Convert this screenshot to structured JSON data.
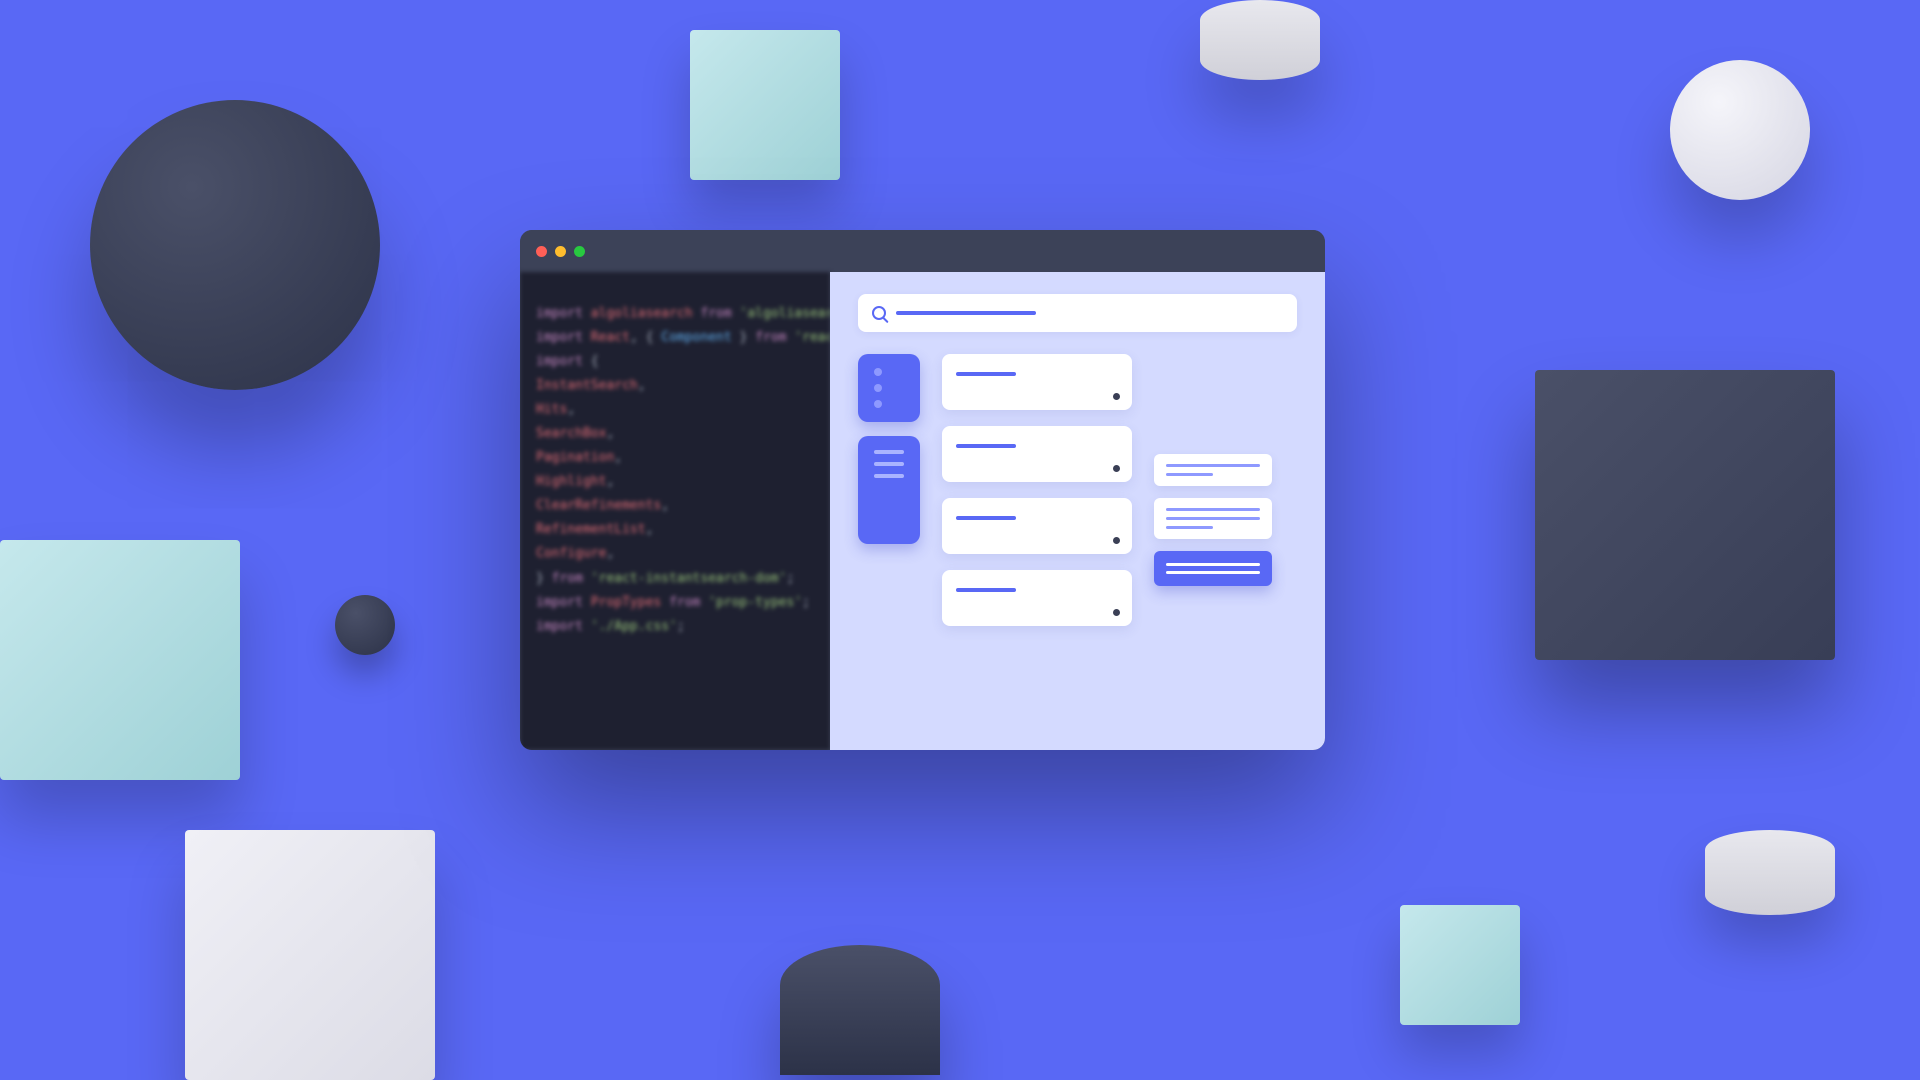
{
  "code": {
    "lines": [
      {
        "tokens": [
          [
            "kw",
            "import "
          ],
          [
            "ident",
            "algoliasearch"
          ],
          [
            "kw",
            " from "
          ],
          [
            "str",
            "'algoliasearch/lite'"
          ],
          [
            "punc",
            ";"
          ]
        ]
      },
      {
        "tokens": [
          [
            "kw",
            "import "
          ],
          [
            "ident",
            "React"
          ],
          [
            "punc",
            ", { "
          ],
          [
            "type",
            "Component"
          ],
          [
            "punc",
            " } "
          ],
          [
            "kw",
            "from "
          ],
          [
            "str",
            "'react'"
          ],
          [
            "punc",
            ";"
          ]
        ]
      },
      {
        "tokens": [
          [
            "kw",
            "import "
          ],
          [
            "punc",
            "{"
          ]
        ]
      },
      {
        "tokens": [
          [
            "ident",
            "  InstantSearch"
          ],
          [
            "punc",
            ","
          ]
        ]
      },
      {
        "tokens": [
          [
            "ident",
            "  Hits"
          ],
          [
            "punc",
            ","
          ]
        ]
      },
      {
        "tokens": [
          [
            "ident",
            "  SearchBox"
          ],
          [
            "punc",
            ","
          ]
        ]
      },
      {
        "tokens": [
          [
            "ident",
            "  Pagination"
          ],
          [
            "punc",
            ","
          ]
        ]
      },
      {
        "tokens": [
          [
            "ident",
            "  Highlight"
          ],
          [
            "punc",
            ","
          ]
        ]
      },
      {
        "tokens": [
          [
            "ident",
            "  ClearRefinements"
          ],
          [
            "punc",
            ","
          ]
        ]
      },
      {
        "tokens": [
          [
            "ident",
            "  RefinementList"
          ],
          [
            "punc",
            ","
          ]
        ]
      },
      {
        "tokens": [
          [
            "ident",
            "  Configure"
          ],
          [
            "punc",
            ","
          ]
        ]
      },
      {
        "tokens": [
          [
            "punc",
            "} "
          ],
          [
            "kw",
            "from "
          ],
          [
            "str",
            "'react-instantsearch-dom'"
          ],
          [
            "punc",
            ";"
          ]
        ]
      },
      {
        "tokens": [
          [
            "kw",
            "import "
          ],
          [
            "ident",
            "PropTypes"
          ],
          [
            "kw",
            " from "
          ],
          [
            "str",
            "'prop-types'"
          ],
          [
            "punc",
            ";"
          ]
        ]
      },
      {
        "tokens": [
          [
            "kw",
            "import "
          ],
          [
            "str",
            "'./App.css'"
          ],
          [
            "punc",
            ";"
          ]
        ]
      }
    ]
  },
  "preview": {
    "results_count": 4,
    "aside_cards": 2
  }
}
